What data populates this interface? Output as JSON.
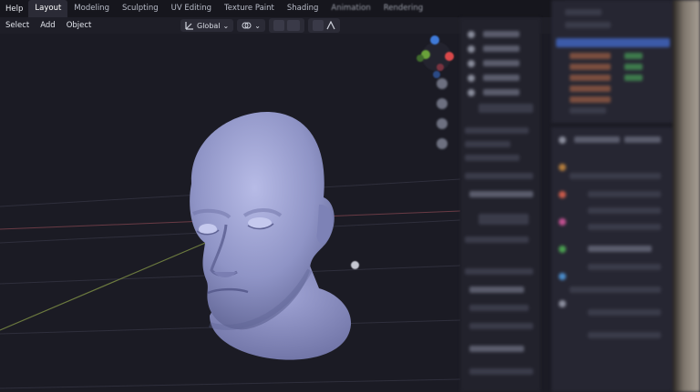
{
  "topbar": {
    "menu_help": "Help",
    "tabs": [
      {
        "label": "Layout",
        "active": true
      },
      {
        "label": "Modeling"
      },
      {
        "label": "Sculpting"
      },
      {
        "label": "UV Editing"
      },
      {
        "label": "Texture Paint"
      },
      {
        "label": "Shading"
      },
      {
        "label": "Animation"
      },
      {
        "label": "Rendering"
      }
    ]
  },
  "header": {
    "menus": [
      "Select",
      "Add",
      "Object"
    ],
    "transform_orientation": "Global"
  },
  "colors": {
    "background": "#1b1b24",
    "mesh": "#8f94c6",
    "gizmo_x": "#d9484a",
    "gizmo_y": "#6aa23a",
    "gizmo_z": "#3f7ad8"
  },
  "viewport": {
    "object": "head-mesh"
  }
}
